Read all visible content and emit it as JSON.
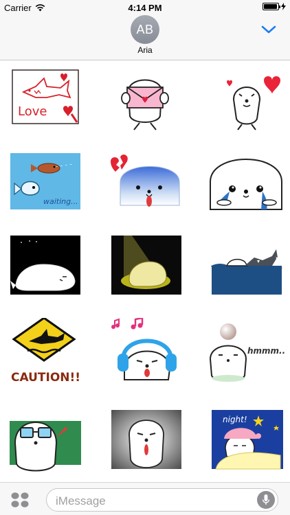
{
  "status_bar": {
    "carrier": "Carrier",
    "time": "4:14 PM",
    "battery_level": 0.95
  },
  "header": {
    "avatar_initials": "AB",
    "contact_name": "Aria"
  },
  "stickers": [
    {
      "name": "sticker-shark-love",
      "text": "Love"
    },
    {
      "name": "sticker-seal-love-letter",
      "text": ""
    },
    {
      "name": "sticker-seal-hearts",
      "text": ""
    },
    {
      "name": "sticker-fish-waiting",
      "text": "waiting..."
    },
    {
      "name": "sticker-seal-broken-heart",
      "text": ""
    },
    {
      "name": "sticker-seal-crying",
      "text": ""
    },
    {
      "name": "sticker-seal-night",
      "text": ""
    },
    {
      "name": "sticker-seal-spotlight",
      "text": ""
    },
    {
      "name": "sticker-seal-shark-sea",
      "text": ""
    },
    {
      "name": "sticker-caution-shark",
      "text": "CAUTION!!"
    },
    {
      "name": "sticker-seal-headphones",
      "text": ""
    },
    {
      "name": "sticker-seal-ball-thinking",
      "text": "hmmm..."
    },
    {
      "name": "sticker-seal-sunglasses",
      "text": ""
    },
    {
      "name": "sticker-seal-gray",
      "text": ""
    },
    {
      "name": "sticker-seal-good-night",
      "text": "night!"
    }
  ],
  "bottom_bar": {
    "message_placeholder": "iMessage",
    "icons": [
      "app-drawer-icon",
      "microphone-icon"
    ]
  },
  "colors": {
    "accent": "#1a7ef0",
    "bar_background": "#f7f7f7",
    "avatar": "#959aa3"
  }
}
